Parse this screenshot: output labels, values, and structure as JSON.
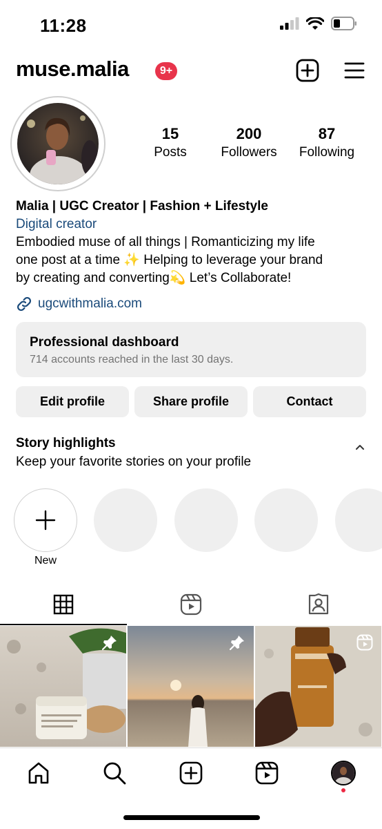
{
  "status_bar": {
    "time": "11:28",
    "icons": [
      "signal-icon",
      "wifi-icon",
      "battery-icon"
    ]
  },
  "header": {
    "username": "muse.malia",
    "notification_badge": "9+",
    "icons": [
      "add-post-icon",
      "menu-icon"
    ]
  },
  "profile": {
    "stats": [
      {
        "value": "15",
        "label": "Posts"
      },
      {
        "value": "200",
        "label": "Followers"
      },
      {
        "value": "87",
        "label": "Following"
      }
    ],
    "name": "Malia | UGC Creator | Fashion + Lifestyle",
    "category": "Digital creator",
    "bio_lines": [
      "Embodied muse of all things | Romanticizing my life",
      "one post at a time ✨ Helping to leverage your brand",
      "by creating and converting💫 Let’s Collaborate!"
    ],
    "link": "ugcwithmalia.com"
  },
  "dashboard": {
    "title": "Professional dashboard",
    "subtitle": "714 accounts reached in the last 30 days."
  },
  "actions": {
    "edit": "Edit profile",
    "share": "Share profile",
    "contact": "Contact"
  },
  "highlights": {
    "title": "Story highlights",
    "subtitle": "Keep your favorite stories on your profile",
    "new_label": "New"
  },
  "tabs": [
    "grid-icon",
    "reels-icon",
    "tagged-icon"
  ],
  "posts": [
    {
      "icon": "pin-icon"
    },
    {
      "icon": "pin-icon"
    },
    {
      "icon": "reel-icon"
    }
  ],
  "colors": {
    "link_blue": "#1a4a7a",
    "badge_red": "#e8344b",
    "button_gray": "#efefef",
    "muted_text": "#737373"
  },
  "bottom_nav": [
    "home-icon",
    "search-icon",
    "create-icon",
    "reels-icon",
    "profile-avatar"
  ]
}
